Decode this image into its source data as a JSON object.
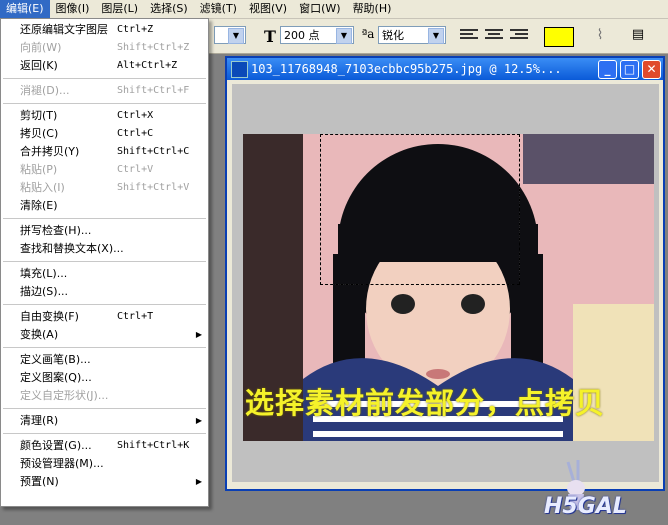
{
  "menubar": [
    {
      "label": "编辑(E)",
      "active": true
    },
    {
      "label": "图像(I)"
    },
    {
      "label": "图层(L)"
    },
    {
      "label": "选择(S)"
    },
    {
      "label": "滤镜(T)"
    },
    {
      "label": "视图(V)"
    },
    {
      "label": "窗口(W)"
    },
    {
      "label": "帮助(H)"
    }
  ],
  "options": {
    "font_size": "200 点",
    "antialias": "锐化",
    "text_color": "#ffff00"
  },
  "document": {
    "title": "103_11768948_7103ecbbc95b275.jpg @ 12.5%...",
    "caption": "选择素材前发部分，点拷贝"
  },
  "edit_menu": [
    {
      "label": "还原编辑文字图层",
      "shortcut": "Ctrl+Z"
    },
    {
      "label": "向前(W)",
      "shortcut": "Shift+Ctrl+Z",
      "disabled": true
    },
    {
      "label": "返回(K)",
      "shortcut": "Alt+Ctrl+Z"
    },
    {
      "sep": true
    },
    {
      "label": "消褪(D)...",
      "shortcut": "Shift+Ctrl+F",
      "disabled": true
    },
    {
      "sep": true
    },
    {
      "label": "剪切(T)",
      "shortcut": "Ctrl+X"
    },
    {
      "label": "拷贝(C)",
      "shortcut": "Ctrl+C"
    },
    {
      "label": "合并拷贝(Y)",
      "shortcut": "Shift+Ctrl+C"
    },
    {
      "label": "粘贴(P)",
      "shortcut": "Ctrl+V",
      "disabled": true
    },
    {
      "label": "粘贴入(I)",
      "shortcut": "Shift+Ctrl+V",
      "disabled": true
    },
    {
      "label": "清除(E)"
    },
    {
      "sep": true
    },
    {
      "label": "拼写检查(H)..."
    },
    {
      "label": "查找和替换文本(X)..."
    },
    {
      "sep": true
    },
    {
      "label": "填充(L)..."
    },
    {
      "label": "描边(S)..."
    },
    {
      "sep": true
    },
    {
      "label": "自由变换(F)",
      "shortcut": "Ctrl+T"
    },
    {
      "label": "变换(A)",
      "submenu": true
    },
    {
      "sep": true
    },
    {
      "label": "定义画笔(B)..."
    },
    {
      "label": "定义图案(Q)..."
    },
    {
      "label": "定义自定形状(J)...",
      "disabled": true
    },
    {
      "sep": true
    },
    {
      "label": "清理(R)",
      "submenu": true
    },
    {
      "sep": true
    },
    {
      "label": "颜色设置(G)...",
      "shortcut": "Shift+Ctrl+K"
    },
    {
      "label": "预设管理器(M)..."
    },
    {
      "label": "预置(N)",
      "submenu": true
    }
  ],
  "watermark": "H5GAL"
}
